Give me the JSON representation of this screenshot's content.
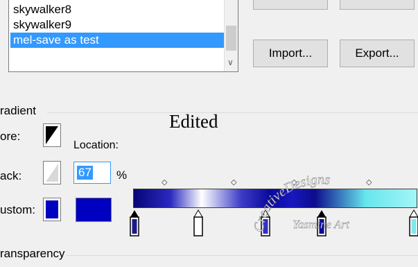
{
  "presets": {
    "items": [
      {
        "label": "skywalker8"
      },
      {
        "label": "skywalker9"
      },
      {
        "label": "mel-save as test",
        "selected": true
      }
    ]
  },
  "buttons": {
    "import_label": "Import...",
    "export_label": "Export..."
  },
  "gradient_group": {
    "title": "radient",
    "fore_label": "ore:",
    "back_label": "ack:",
    "custom_label": "ustom:",
    "location_label": "Location:",
    "location_value": "67",
    "location_unit": "%"
  },
  "transparency_group": {
    "title": "ransparency"
  },
  "overlay": {
    "edited": "Edited",
    "watermark_line1": "CreativeDesigns",
    "watermark_line2": "Yasmine Art"
  },
  "colors": {
    "selection": "#3399ff",
    "custom_color": "#0000c0",
    "gradient_dark": "#060678",
    "gradient_mid": "#0a0a9a",
    "gradient_light": "#a4f5f8"
  },
  "icons": {
    "fore_swatch": "fore-background-swatch-icon",
    "back_swatch": "back-foreground-swatch-icon",
    "color_stop": "color-stop-icon",
    "opacity_marker": "diamond-midpoint-icon"
  }
}
